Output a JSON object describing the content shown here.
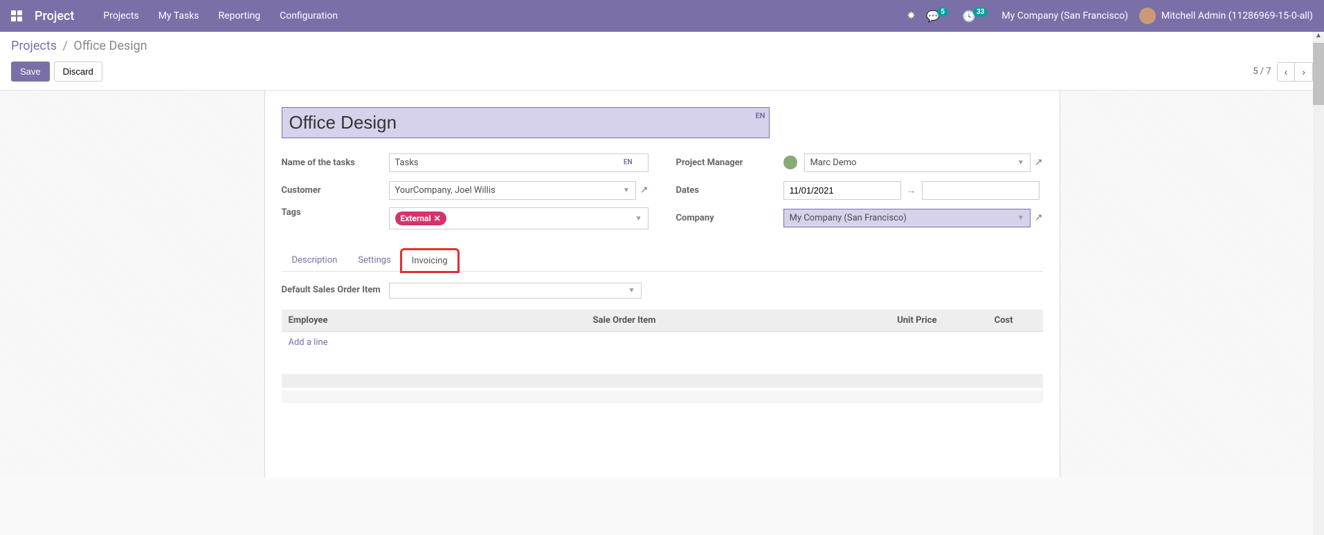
{
  "navbar": {
    "app_title": "Project",
    "menu": [
      "Projects",
      "My Tasks",
      "Reporting",
      "Configuration"
    ],
    "chat_badge": "5",
    "activity_badge": "33",
    "company": "My Company (San Francisco)",
    "user": "Mitchell Admin (11286969-15-0-all)"
  },
  "breadcrumb": {
    "parent": "Projects",
    "current": "Office Design"
  },
  "buttons": {
    "save": "Save",
    "discard": "Discard"
  },
  "pager": {
    "info": "5 / 7"
  },
  "form": {
    "title_value": "Office Design",
    "lang_badge": "EN",
    "fields": {
      "name_of_tasks_label": "Name of the tasks",
      "name_of_tasks_value": "Tasks",
      "customer_label": "Customer",
      "customer_value": "YourCompany, Joel Willis",
      "tags_label": "Tags",
      "tag_value": "External",
      "pm_label": "Project Manager",
      "pm_value": "Marc Demo",
      "dates_label": "Dates",
      "date_start": "11/01/2021",
      "date_end": "",
      "company_label": "Company",
      "company_value": "My Company (San Francisco)"
    }
  },
  "tabs": {
    "items": [
      "Description",
      "Settings",
      "Invoicing"
    ],
    "active_index": 2
  },
  "invoicing": {
    "default_soi_label": "Default Sales Order Item",
    "default_soi_value": "",
    "columns": {
      "employee": "Employee",
      "sale_order_item": "Sale Order Item",
      "unit_price": "Unit Price",
      "cost": "Cost"
    },
    "add_line": "Add a line"
  }
}
